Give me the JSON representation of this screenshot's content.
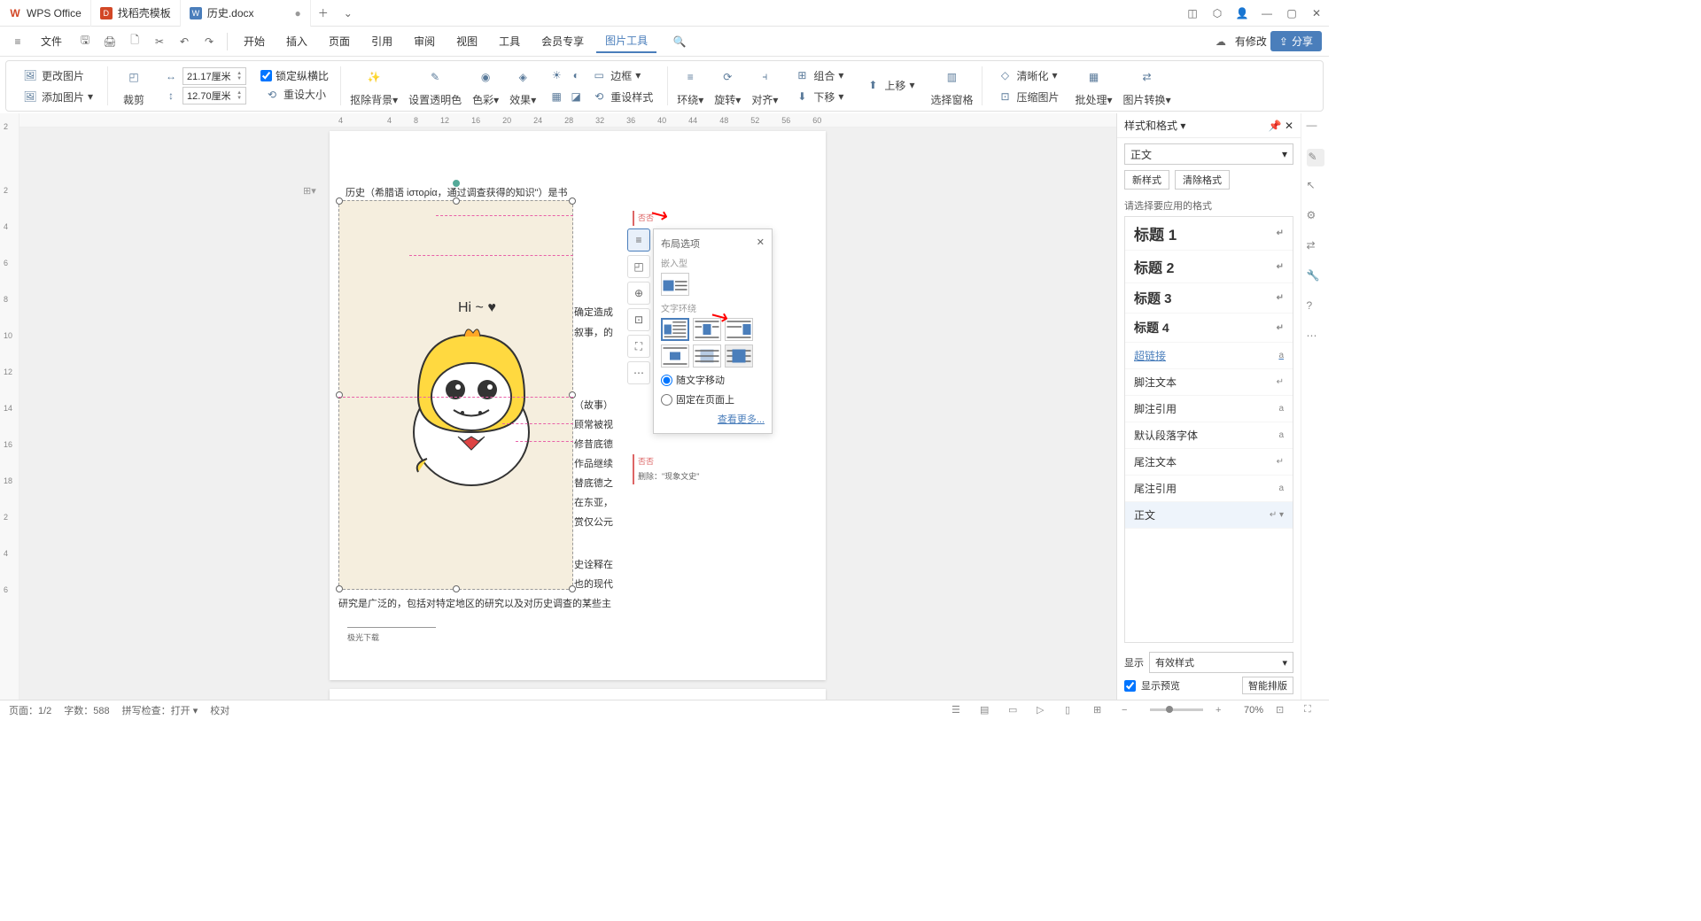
{
  "titlebar": {
    "app_name": "WPS Office",
    "tabs": [
      {
        "label": "找稻壳模板",
        "icon": "D"
      },
      {
        "label": "历史.docx",
        "icon": "W",
        "modified": "●"
      }
    ]
  },
  "menubar": {
    "file_label": "文件",
    "items": [
      "开始",
      "插入",
      "页面",
      "引用",
      "审阅",
      "视图",
      "工具",
      "会员专享",
      "图片工具"
    ],
    "active_index": 8,
    "has_changes": "有修改",
    "share": "分享"
  },
  "ribbon": {
    "change_image": "更改图片",
    "add_image": "添加图片",
    "crop": "裁剪",
    "width_val": "21.17厘米",
    "height_val": "12.70厘米",
    "lock_ratio": "锁定纵横比",
    "reset_size": "重设大小",
    "remove_bg": "抠除背景",
    "set_transparent": "设置透明色",
    "color": "色彩",
    "effect": "效果",
    "border": "边框",
    "reset_style": "重设样式",
    "wrap": "环绕",
    "rotate": "旋转",
    "align": "对齐",
    "combine": "组合",
    "move_up": "上移",
    "move_down": "下移",
    "sel_pane": "选择窗格",
    "sharpen": "清晰化",
    "compress": "压缩图片",
    "batch": "批处理",
    "convert": "图片转换"
  },
  "ruler_h": [
    "4",
    "",
    "4",
    "8",
    "12",
    "16",
    "20",
    "24",
    "28",
    "32",
    "36",
    "40",
    "44",
    "48",
    "52",
    "56",
    "60"
  ],
  "ruler_v": [
    "2",
    "",
    "2",
    "4",
    "6",
    "8",
    "10",
    "12",
    "14",
    "16",
    "18",
    "2",
    "4",
    "6"
  ],
  "document": {
    "line1": "历史（希腊语 ἱστορία，通过调查获得的知识\"）是书",
    "hi": "Hi ~ ♥",
    "frag1": "确定造成",
    "frag2": "叙事，的",
    "frag3": "（故事）",
    "frag4": "顾常被视",
    "frag5": "修昔底德",
    "frag6": "作品继续",
    "frag7": "替底德之",
    "frag8": "在东亚，",
    "frag9": "赏仅公元",
    "frag10": "史诠释在",
    "frag11": "也的现代",
    "line_bottom": "研究是广泛的，包括对特定地区的研究以及对历史调查的某些主",
    "footer_txt": "极光下载",
    "comment1": "否否",
    "comment2": "删除：\"现象文史\""
  },
  "popup": {
    "title": "布局选项",
    "sec1": "嵌入型",
    "sec2": "文字环绕",
    "radio1": "随文字移动",
    "radio2": "固定在页面上",
    "more": "查看更多..."
  },
  "rightpanel": {
    "title": "样式和格式",
    "current_style": "正文",
    "new_style": "新样式",
    "clear_fmt": "清除格式",
    "prompt": "请选择要应用的格式",
    "styles": [
      {
        "label": "标题 1",
        "cls": "h1"
      },
      {
        "label": "标题 2",
        "cls": "h2"
      },
      {
        "label": "标题 3",
        "cls": "h3"
      },
      {
        "label": "标题 4",
        "cls": "h4"
      },
      {
        "label": "超链接",
        "cls": "link"
      },
      {
        "label": "脚注文本",
        "cls": ""
      },
      {
        "label": "脚注引用",
        "cls": ""
      },
      {
        "label": "默认段落字体",
        "cls": ""
      },
      {
        "label": "尾注文本",
        "cls": ""
      },
      {
        "label": "尾注引用",
        "cls": ""
      },
      {
        "label": "正文",
        "cls": "sel"
      }
    ],
    "show_label": "显示",
    "show_value": "有效样式",
    "preview_chk": "显示预览",
    "smart_layout": "智能排版"
  },
  "statusbar": {
    "page": "页面：1/2",
    "words": "字数：588",
    "spell": "拼写检查：打开",
    "proof": "校对",
    "zoom": "70%"
  }
}
